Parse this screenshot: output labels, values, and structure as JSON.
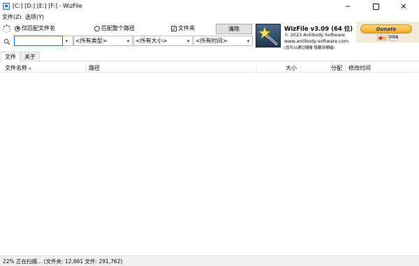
{
  "window": {
    "title": "[C:] [D:] [E:] [F:]  - WizFile",
    "minimize": "─",
    "close": "✕"
  },
  "menu": {
    "items": [
      "文件(Z)",
      "选项(Y)"
    ]
  },
  "options": {
    "match_filename": "仅匹配文件名",
    "match_path": "匹配整个路径",
    "folders": "文件夹",
    "folders_check": "✓",
    "clear": "清除"
  },
  "filters": {
    "search_value": "",
    "type": "<所有类型>",
    "size": "<所有大小>",
    "time": "<所有时间>",
    "dropdown_arrow": "▾"
  },
  "info": {
    "title": "WizFile v3.09 (64 位)",
    "copyright": "© 2023 Antibody Software",
    "website": "www.antibody-software.com",
    "note": "(您可以通过捐赠 隐藏该横幅)"
  },
  "donate": {
    "label": "Donate",
    "visa": "VISA"
  },
  "tabs": [
    "文件",
    "关于"
  ],
  "columns": {
    "name": "文件名称",
    "sort_indicator": "▲",
    "path": "路径",
    "size": "大小",
    "alloc": "分配",
    "modified": "修改时间"
  },
  "status": {
    "text": "22% 正在扫描... (文件夹: 12,661  文件: 291,762)"
  },
  "colors": {
    "accent": "#0078d7",
    "donate": "#f5a623"
  }
}
